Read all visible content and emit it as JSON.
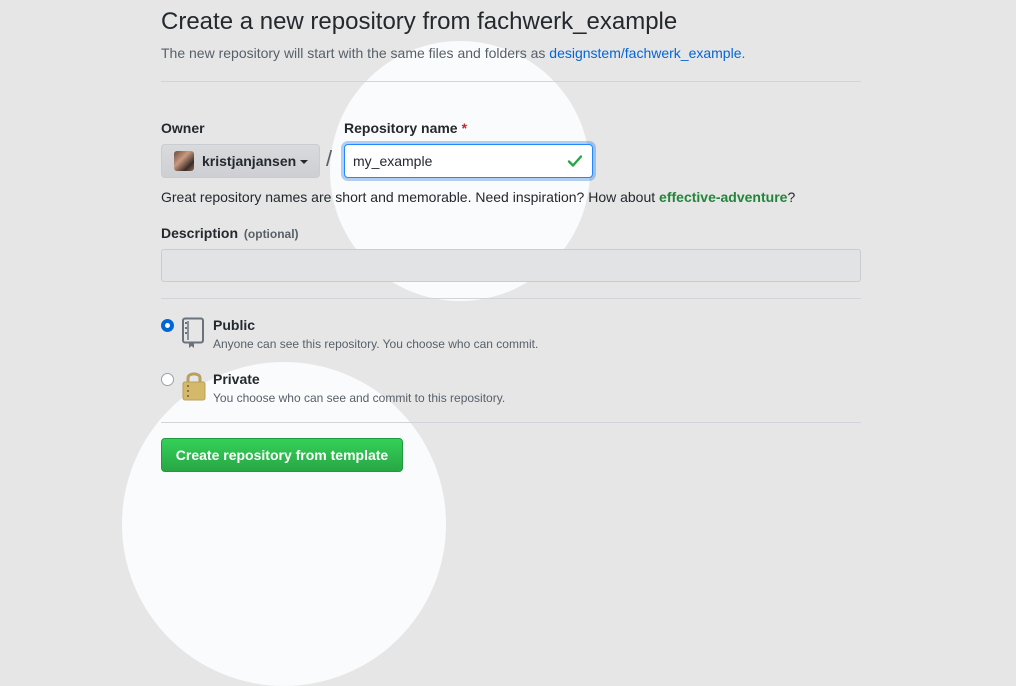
{
  "header": {
    "title": "Create a new repository from fachwerk_example",
    "subtitle_prefix": "The new repository will start with the same files and folders as ",
    "template_link": "designstem/fachwerk_example",
    "subtitle_suffix": "."
  },
  "owner": {
    "label": "Owner",
    "selected": "kristjanjansen"
  },
  "separator": "/",
  "repository": {
    "label": "Repository name",
    "required_mark": "*",
    "value": "my_example"
  },
  "hint": {
    "text": "Great repository names are short and memorable. Need inspiration? How about ",
    "suggestion": "effective-adventure",
    "suffix": "?"
  },
  "description": {
    "label": "Description",
    "optional": "(optional)",
    "value": ""
  },
  "visibility": {
    "selected": "public",
    "public": {
      "title": "Public",
      "description": "Anyone can see this repository. You choose who can commit."
    },
    "private": {
      "title": "Private",
      "description": "You choose who can see and commit to this repository."
    }
  },
  "submit_label": "Create repository from template",
  "colors": {
    "link": "#0366d6",
    "success": "#28a745",
    "suggestion": "#22863a",
    "required": "#cb2431"
  },
  "icons": {
    "valid": "check-icon",
    "public": "repo-icon",
    "private": "lock-icon",
    "owner_dropdown": "caret-down-icon"
  }
}
